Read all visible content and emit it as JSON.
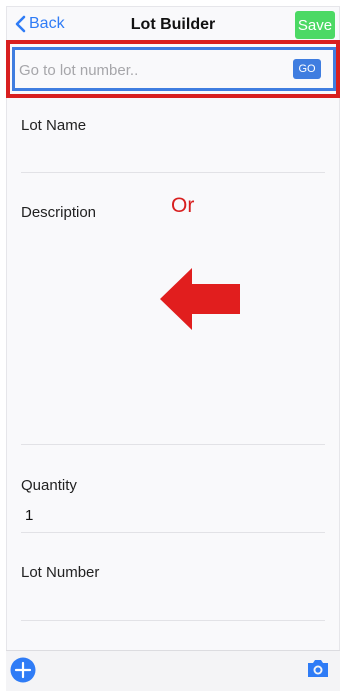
{
  "nav": {
    "back_label": "Back",
    "title": "Lot Builder",
    "save_label": "Save"
  },
  "search": {
    "placeholder": "Go to lot number..",
    "value": "",
    "go_label": "GO"
  },
  "form": {
    "lot_name_label": "Lot Name",
    "description_label": "Description",
    "quantity_label": "Quantity",
    "quantity_value": "1",
    "lot_number_label": "Lot Number"
  },
  "annotation": {
    "or_text": "Or"
  },
  "colors": {
    "accent": "#3f7de0",
    "save": "#4cd964",
    "annotation": "#d81f1f"
  },
  "icons": {
    "back": "chevron-left-icon",
    "add": "plus-circle-icon",
    "camera": "camera-icon",
    "arrow": "left-arrow-icon"
  }
}
